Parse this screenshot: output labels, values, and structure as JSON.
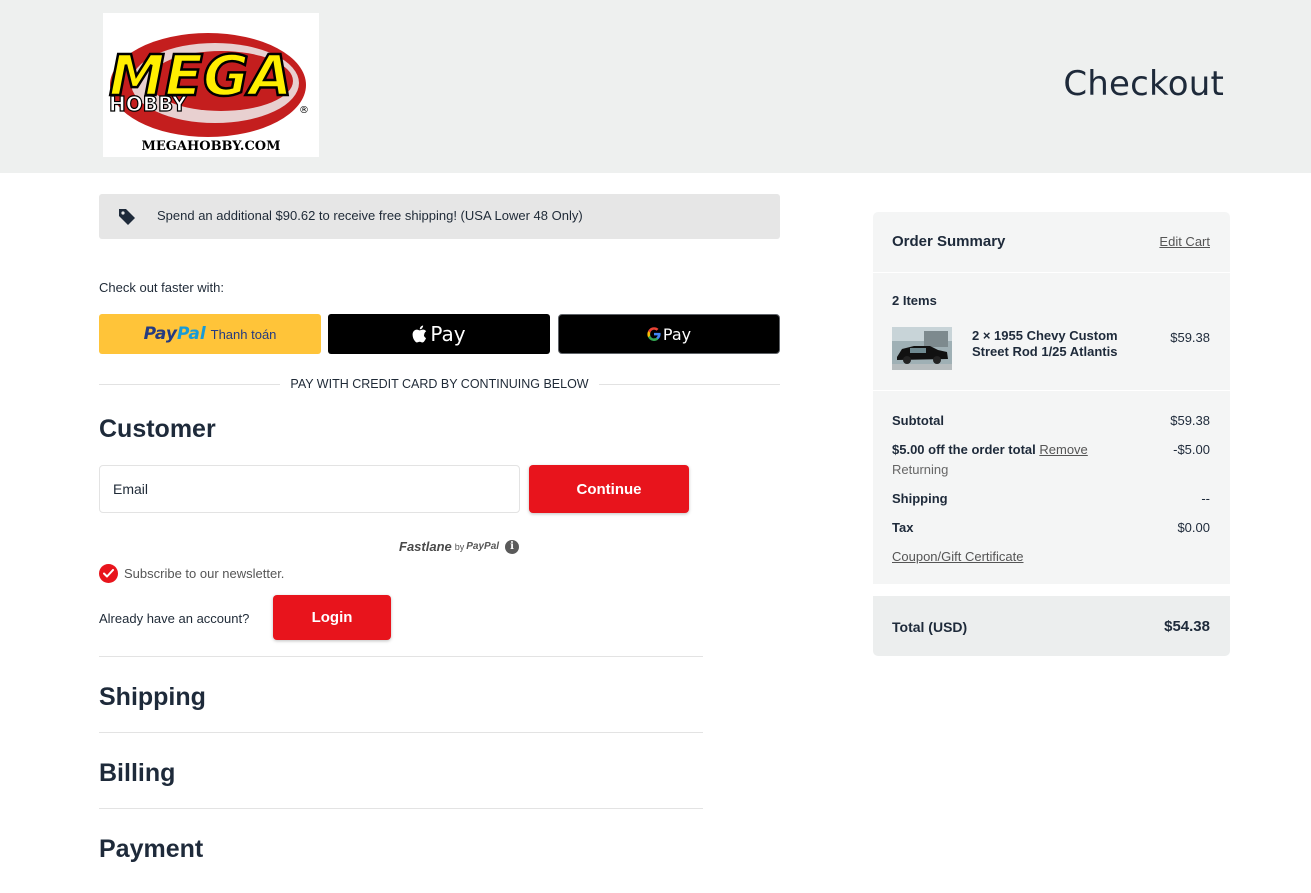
{
  "header": {
    "logo": {
      "main": "MEGA",
      "sub": "HOBBY",
      "registered": "®",
      "site": "MEGAHOBBY.COM"
    },
    "title": "Checkout"
  },
  "promo": {
    "icon": "tag-icon",
    "text": "Spend an additional $90.62 to receive free shipping! (USA Lower 48 Only)"
  },
  "express": {
    "label": "Check out faster with:",
    "paypal": {
      "logo_part1": "Pay",
      "logo_part2": "Pal",
      "label": "Thanh toán"
    },
    "applepay": {
      "icon": "apple-icon",
      "label": "Pay"
    },
    "googlepay": {
      "icon": "google-g-icon",
      "g": "G",
      "label": "Pay"
    },
    "divider": "PAY WITH CREDIT CARD BY CONTINUING BELOW"
  },
  "customer": {
    "heading": "Customer",
    "email_placeholder": "Email",
    "continue_label": "Continue",
    "fastlane": {
      "word": "Fastlane",
      "by": "by",
      "brand": "PayPal",
      "info": "i"
    },
    "newsletter": {
      "checked": true,
      "label": "Subscribe to our newsletter."
    },
    "account_question": "Already have an account?",
    "login_label": "Login"
  },
  "sections": {
    "shipping": "Shipping",
    "billing": "Billing",
    "payment": "Payment"
  },
  "summary": {
    "title": "Order Summary",
    "edit_cart": "Edit Cart",
    "items_count": "2 Items",
    "item": {
      "name": "2 × 1955 Chevy Custom Street Rod 1/25 Atlantis",
      "price": "$59.38"
    },
    "subtotal": {
      "label": "Subtotal",
      "value": "$59.38"
    },
    "discount": {
      "label": "$5.00 off the order total",
      "remove": "Remove",
      "value": "-$5.00",
      "note": "Returning"
    },
    "shipping": {
      "label": "Shipping",
      "value": "--"
    },
    "tax": {
      "label": "Tax",
      "value": "$0.00"
    },
    "coupon": "Coupon/Gift Certificate",
    "total": {
      "label": "Total (USD)",
      "value": "$54.38"
    }
  },
  "colors": {
    "brand_red": "#e8141c",
    "paypal_yellow": "#ffc439",
    "header_bg": "#eef0ef",
    "panel_bg": "#f4f5f5"
  }
}
